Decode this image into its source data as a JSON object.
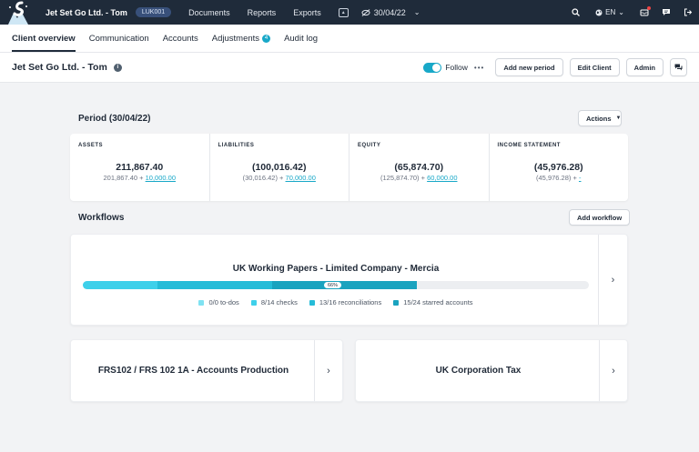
{
  "nav": {
    "client": "Jet Set Go Ltd. - Tom",
    "code": "LUK001",
    "links": [
      "Documents",
      "Reports",
      "Exports"
    ],
    "period": "30/04/22",
    "language": "EN"
  },
  "tabs": [
    {
      "label": "Client overview",
      "active": true
    },
    {
      "label": "Communication"
    },
    {
      "label": "Accounts"
    },
    {
      "label": "Adjustments",
      "count": "4"
    },
    {
      "label": "Audit log"
    }
  ],
  "header": {
    "title": "Jet Set Go Ltd. - Tom",
    "follow_label": "Follow",
    "buttons": {
      "add_period": "Add new period",
      "edit_client": "Edit Client",
      "admin": "Admin"
    }
  },
  "period": {
    "title": "Period (30/04/22)",
    "actions_label": "Actions",
    "metrics": [
      {
        "label": "ASSETS",
        "value": "211,867.40",
        "prev": "201,867.40",
        "plus": "+",
        "delta": "10,000.00"
      },
      {
        "label": "LIABILITIES",
        "value": "(100,016.42)",
        "prev": "(30,016.42)",
        "plus": "+",
        "delta": "70,000.00"
      },
      {
        "label": "EQUITY",
        "value": "(65,874.70)",
        "prev": "(125,874.70)",
        "plus": "+",
        "delta": "60,000.00"
      },
      {
        "label": "INCOME STATEMENT",
        "value": "(45,976.28)",
        "prev": "(45,976.28)",
        "plus": "+",
        "delta": "-"
      }
    ]
  },
  "workflows": {
    "title": "Workflows",
    "add_label": "Add workflow",
    "main": {
      "title": "UK Working Papers - Limited Company - Mercia",
      "progress_label": "66%",
      "progress": 0.66,
      "segments": [
        {
          "fraction": 0.147,
          "color": "#3ed0ea"
        },
        {
          "fraction": 0.227,
          "color": "#25bcd8"
        },
        {
          "fraction": 0.286,
          "color": "#1aa3bf"
        }
      ],
      "legend": [
        {
          "label": "0/0 to-dos",
          "color": "#7fe2f2"
        },
        {
          "label": "8/14 checks",
          "color": "#3ed0ea"
        },
        {
          "label": "13/16 reconciliations",
          "color": "#25bcd8"
        },
        {
          "label": "15/24 starred accounts",
          "color": "#1aa3bf"
        }
      ]
    },
    "cards": [
      {
        "title": "FRS102 / FRS 102 1A - Accounts Production"
      },
      {
        "title": "UK Corporation Tax"
      }
    ]
  },
  "colors": {
    "nav_bg": "#1f2b3a",
    "accent": "#18a8c8"
  }
}
